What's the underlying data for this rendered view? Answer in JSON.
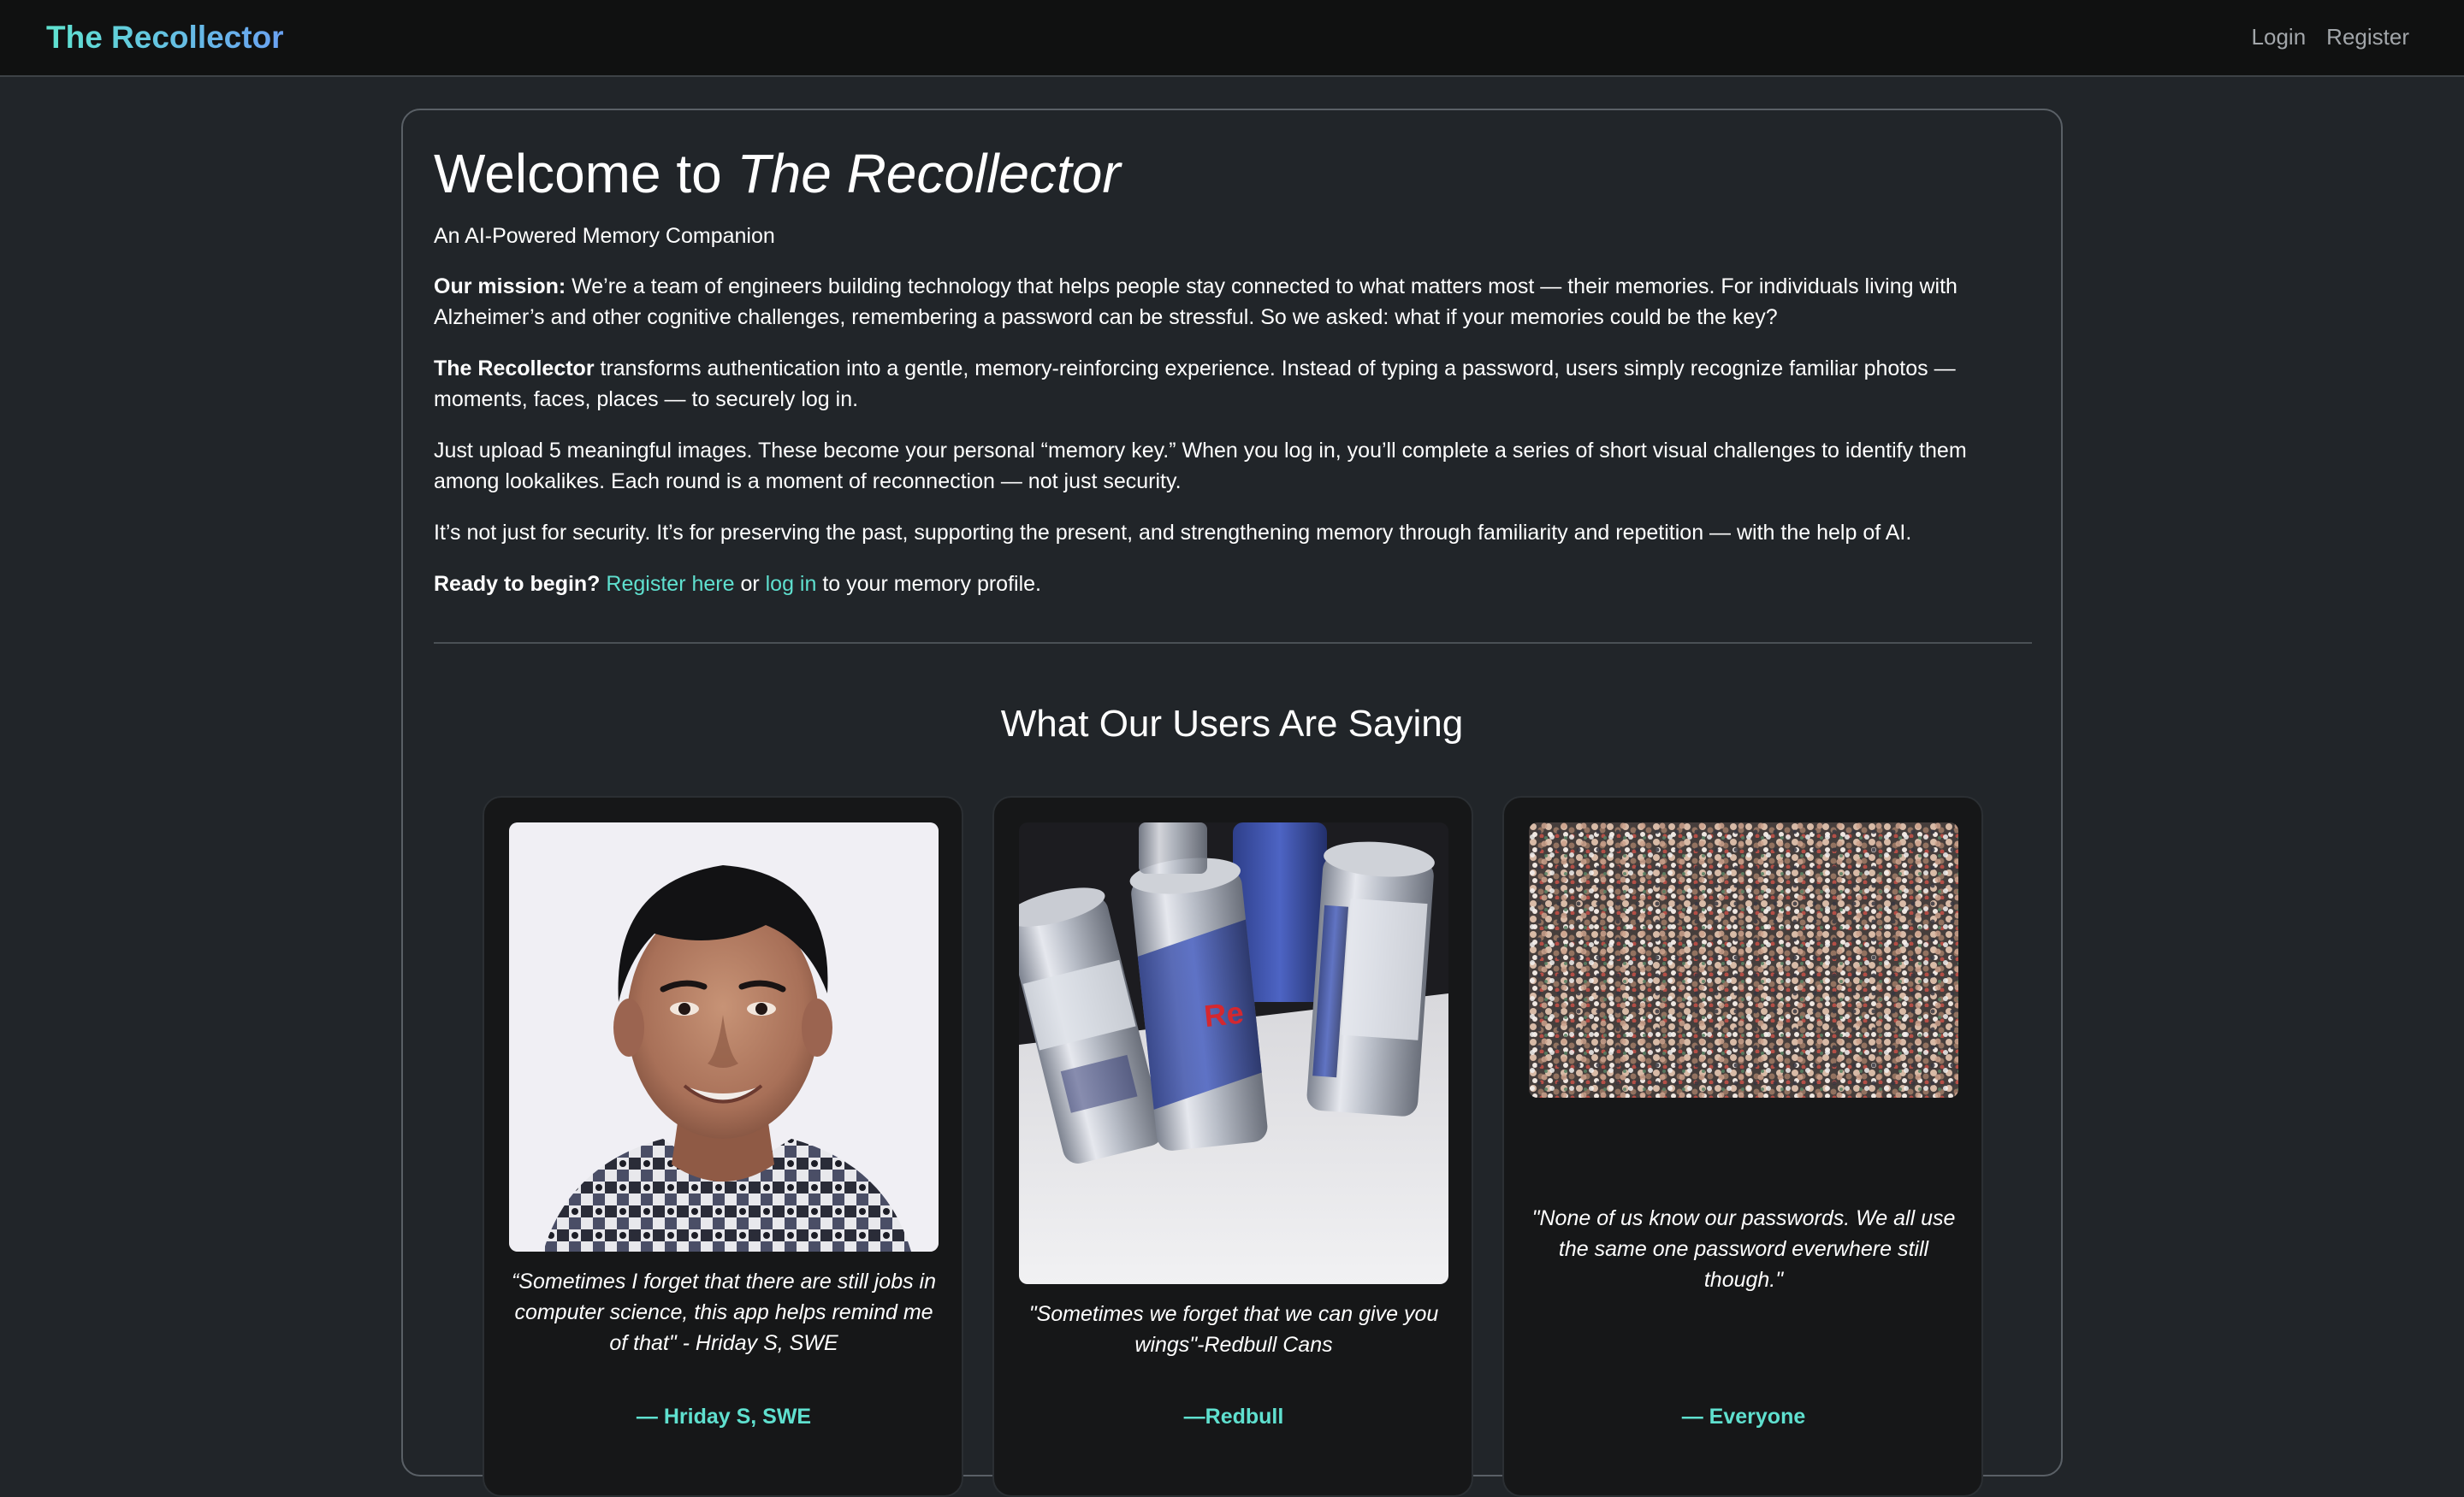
{
  "nav": {
    "brand": "The Recollector",
    "login": "Login",
    "register": "Register"
  },
  "hero": {
    "title_prefix": "Welcome to ",
    "title_name": "The Recollector",
    "subtitle": "An AI-Powered Memory Companion"
  },
  "mission": {
    "label": "Our mission:",
    "text": " We’re a team of engineers building technology that helps people stay connected to what matters most — their memories. For individuals living with Alzheimer’s and other cognitive challenges, remembering a password can be stressful. So we asked: what if your memories could be the key?"
  },
  "about": {
    "label": "The Recollector",
    "text": " transforms authentication into a gentle, memory-reinforcing experience. Instead of typing a password, users simply recognize familiar photos — moments, faces, places — to securely log in."
  },
  "upload_paragraph": "Just upload 5 meaningful images. These become your personal “memory key.” When you log in, you’ll complete a series of short visual challenges to identify them among lookalikes. Each round is a moment of reconnection — not just security.",
  "security_paragraph": "It’s not just for security. It’s for preserving the past, supporting the present, and strengthening memory through familiarity and repetition — with the help of AI.",
  "cta": {
    "label": "Ready to begin?",
    "register_link": "Register here",
    "or": " or ",
    "login_link": "log in",
    "suffix": " to your memory profile."
  },
  "testimonials": {
    "heading": "What Our Users Are Saying",
    "items": [
      {
        "quote": "“Sometimes I forget that there are still jobs in computer science, this app helps remind me of that\" - Hriday S, SWE",
        "author": "— Hriday S, SWE"
      },
      {
        "quote": "\"Sometimes we forget that we can give you wings\"-Redbull Cans",
        "author": "—Redbull"
      },
      {
        "quote": "\"None of us know our passwords. We all use the same one password everwhere still though.\"",
        "author": "— Everyone"
      }
    ]
  },
  "colors": {
    "page_bg": "#212529",
    "navbar_bg": "#101111",
    "accent": "#5fe0cf",
    "brand_gradient_end": "#6aa2f3",
    "card_bg": "#161718"
  }
}
